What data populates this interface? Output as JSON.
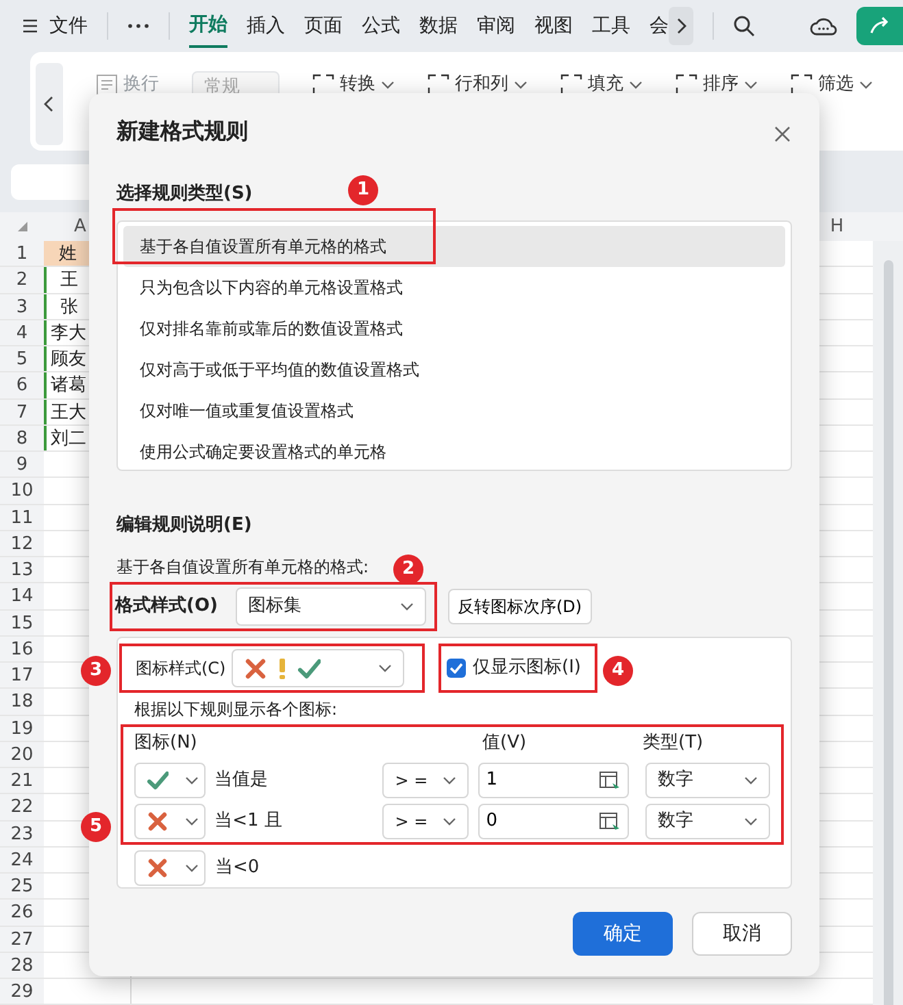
{
  "app": {
    "menu_label": "文件",
    "tabs": [
      {
        "label": "开始",
        "selected": true
      },
      {
        "label": "插入",
        "selected": false
      },
      {
        "label": "页面",
        "selected": false
      },
      {
        "label": "公式",
        "selected": false
      },
      {
        "label": "数据",
        "selected": false
      },
      {
        "label": "审阅",
        "selected": false
      },
      {
        "label": "视图",
        "selected": false
      },
      {
        "label": "工具",
        "selected": false
      },
      {
        "label": "会",
        "selected": false
      }
    ]
  },
  "ribbon": {
    "items": [
      {
        "label": "换行",
        "kind": "button"
      },
      {
        "label": "常规",
        "kind": "select"
      },
      {
        "label": "转换",
        "kind": "menu"
      },
      {
        "label": "行和列",
        "kind": "menu"
      },
      {
        "label": "填充",
        "kind": "menu"
      },
      {
        "label": "排序",
        "kind": "menu"
      },
      {
        "label": "筛选",
        "kind": "menu"
      }
    ]
  },
  "sheet": {
    "columns": [
      "A",
      "H"
    ],
    "rows": [
      {
        "number": "1",
        "cell": "姓",
        "kind": "header"
      },
      {
        "number": "2",
        "cell": "王",
        "kind": "centered"
      },
      {
        "number": "3",
        "cell": "张",
        "kind": "centered"
      },
      {
        "number": "4",
        "cell": "李大",
        "kind": "left"
      },
      {
        "number": "5",
        "cell": "顾友",
        "kind": "left"
      },
      {
        "number": "6",
        "cell": "诸葛",
        "kind": "left"
      },
      {
        "number": "7",
        "cell": "王大",
        "kind": "left"
      },
      {
        "number": "8",
        "cell": "刘二",
        "kind": "left"
      },
      {
        "number": "9"
      },
      {
        "number": "10"
      },
      {
        "number": "11"
      },
      {
        "number": "12"
      },
      {
        "number": "13"
      },
      {
        "number": "14"
      },
      {
        "number": "15"
      },
      {
        "number": "16"
      },
      {
        "number": "17"
      },
      {
        "number": "18"
      },
      {
        "number": "19"
      },
      {
        "number": "20"
      },
      {
        "number": "21"
      },
      {
        "number": "22"
      },
      {
        "number": "23"
      },
      {
        "number": "24"
      },
      {
        "number": "25"
      },
      {
        "number": "26"
      },
      {
        "number": "27"
      },
      {
        "number": "28"
      },
      {
        "number": "29"
      }
    ]
  },
  "dialog": {
    "title": "新建格式规则",
    "rule_type": {
      "heading": "选择规则类型(S)",
      "items": [
        {
          "label": "基于各自值设置所有单元格的格式",
          "selected": true,
          "marker": "1"
        },
        {
          "label": "只为包含以下内容的单元格设置格式",
          "selected": false
        },
        {
          "label": "仅对排名靠前或靠后的数值设置格式",
          "selected": false
        },
        {
          "label": "仅对高于或低于平均值的数值设置格式",
          "selected": false
        },
        {
          "label": "仅对唯一值或重复值设置格式",
          "selected": false
        },
        {
          "label": "使用公式确定要设置格式的单元格",
          "selected": false
        }
      ]
    },
    "edit": {
      "heading": "编辑规则说明(E)",
      "description": "基于各自值设置所有单元格的格式:",
      "marker": "2",
      "format_style": {
        "label": "格式样式(O)",
        "value": "图标集"
      },
      "reverse_button": "反转图标次序(D)",
      "icon_style": {
        "label": "图标样式(C)",
        "marker": "3",
        "icons": [
          {
            "kind": "cross"
          },
          {
            "kind": "exclaim"
          },
          {
            "kind": "check"
          }
        ]
      },
      "show_icon_only": {
        "label": "仅显示图标(I)",
        "checked": true,
        "marker": "4"
      },
      "rules_caption": "根据以下规则显示各个图标:",
      "rules": {
        "marker": "5",
        "headers": [
          "图标(N)",
          "值(V)",
          "类型(T)"
        ],
        "rows": [
          {
            "kind": "check",
            "condition": "当值是",
            "operator": "> =",
            "value": "1",
            "type": "数字"
          },
          {
            "kind": "cross",
            "condition": "当<1 且",
            "operator": "> =",
            "value": "0",
            "type": "数字"
          }
        ]
      },
      "last_rule": {
        "kind": "cross",
        "condition": "当<0"
      }
    },
    "buttons": [
      {
        "label": "确定",
        "kind": "primary"
      },
      {
        "label": "取消",
        "kind": "secondary"
      }
    ]
  }
}
